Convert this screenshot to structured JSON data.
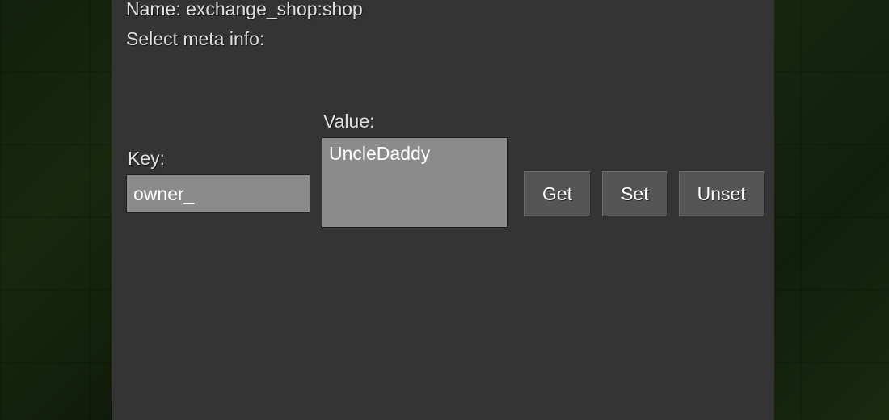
{
  "header": {
    "name_label": "Name:",
    "name_value": "exchange_shop:shop",
    "sub_label": "Select meta info:"
  },
  "form": {
    "key_label": "Key:",
    "key_value": "owner_",
    "value_label": "Value:",
    "value_value": "UncleDaddy"
  },
  "buttons": {
    "get": "Get",
    "set": "Set",
    "unset": "Unset"
  }
}
